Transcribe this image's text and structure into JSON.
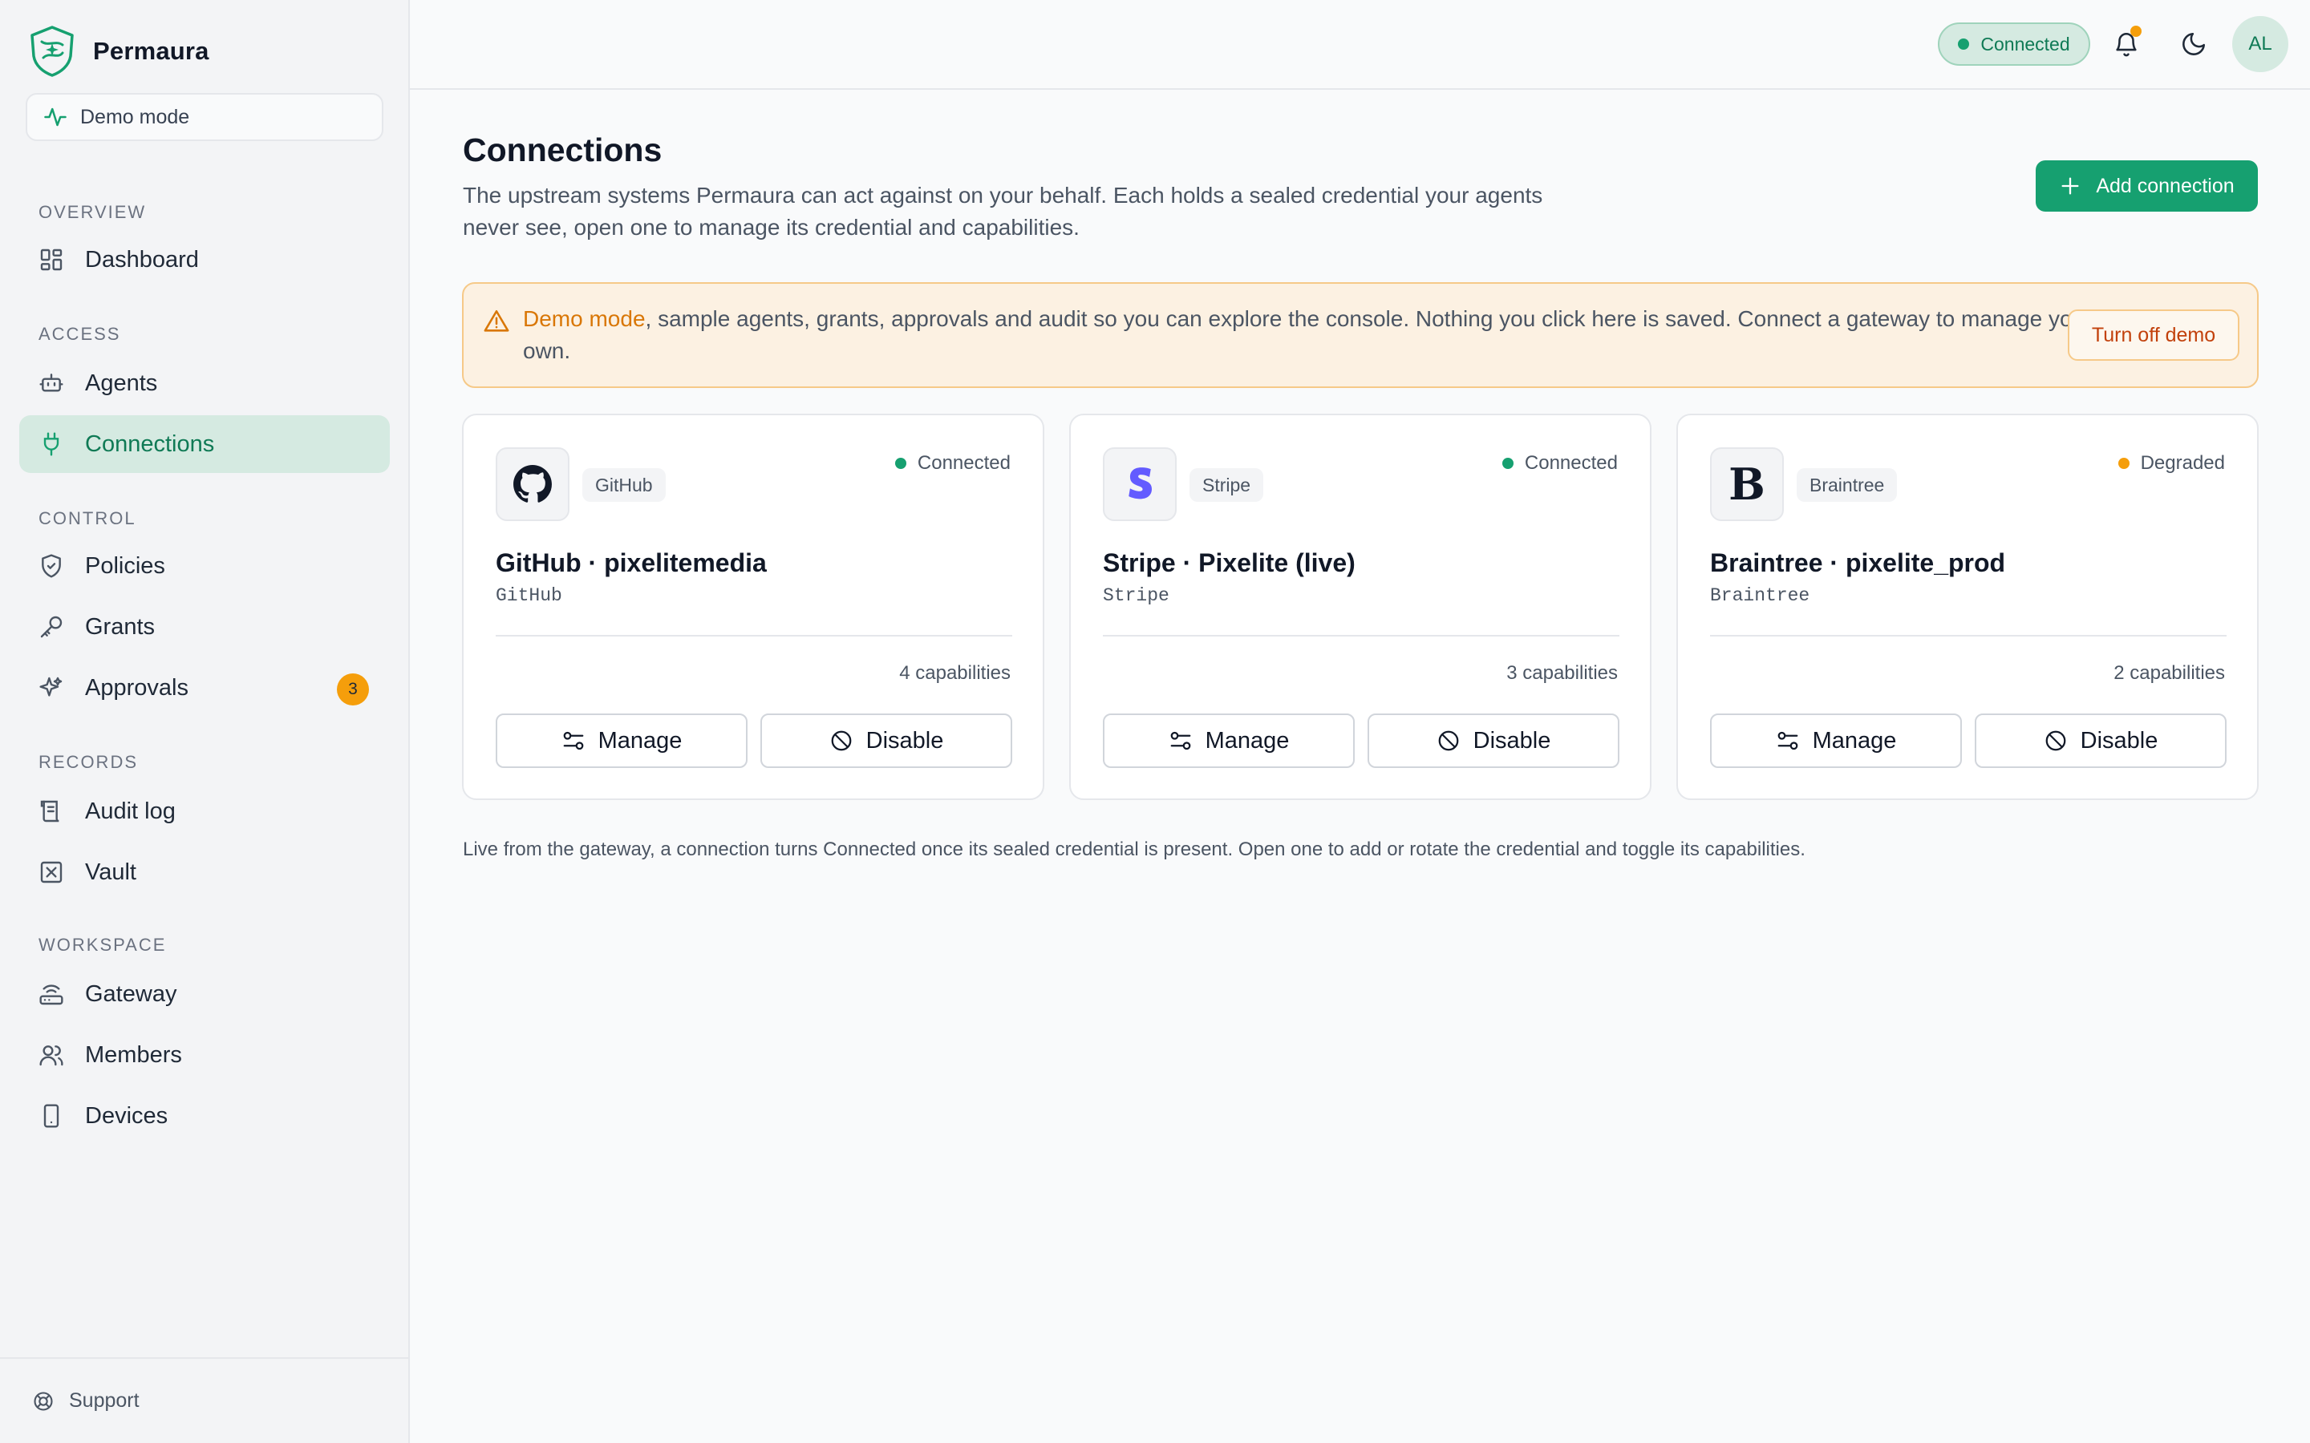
{
  "sidebar": {
    "brand": "Permaura",
    "demo_mode": "Demo mode",
    "sections": {
      "overview": "OVERVIEW",
      "access": "ACCESS",
      "control": "CONTROL",
      "records": "RECORDS",
      "workspace": "WORKSPACE"
    },
    "items": {
      "dashboard": "Dashboard",
      "agents": "Agents",
      "connections": "Connections",
      "policies": "Policies",
      "grants": "Grants",
      "approvals": "Approvals",
      "approvals_badge": "3",
      "audit_log": "Audit log",
      "vault": "Vault",
      "gateway": "Gateway",
      "members": "Members",
      "devices": "Devices"
    },
    "support": "Support"
  },
  "header": {
    "status": "Connected",
    "avatar": "AL"
  },
  "main": {
    "title": "Connections",
    "description": "The upstream systems Permaura can act against on your behalf. Each holds a sealed credential your agents never see, open one to manage its credential and capabilities.",
    "add_button": "Add connection",
    "banner": {
      "highlight": "Demo mode",
      "text": ", sample agents, grants, approvals and audit so you can explore the console. Nothing you click here is saved. Connect a gateway to manage your own.",
      "button": "Turn off demo"
    },
    "cards": [
      {
        "tag": "GitHub",
        "status": "Connected",
        "title": "GitHub · pixelitemedia",
        "subtitle": "GitHub",
        "capabilities": "4 capabilities",
        "manage": "Manage",
        "disable": "Disable"
      },
      {
        "tag": "Stripe",
        "status": "Connected",
        "title": "Stripe · Pixelite (live)",
        "subtitle": "Stripe",
        "capabilities": "3 capabilities",
        "manage": "Manage",
        "disable": "Disable"
      },
      {
        "tag": "Braintree",
        "status": "Degraded",
        "title": "Braintree · pixelite_prod",
        "subtitle": "Braintree",
        "capabilities": "2 capabilities",
        "manage": "Manage",
        "disable": "Disable",
        "logo_letter": "B"
      }
    ],
    "footer_note": "Live from the gateway, a connection turns Connected once its sealed credential is present. Open one to add or rotate the credential and toggle its capabilities."
  },
  "colors": {
    "accent": "#16a070",
    "connected": "#16a070",
    "degraded": "#f59e0b",
    "stripe": "#635bff",
    "warning": "#d97706"
  }
}
